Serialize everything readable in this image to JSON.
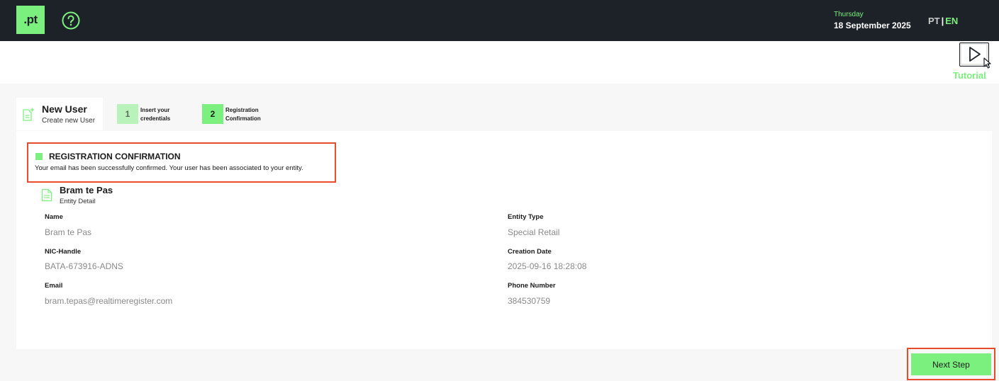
{
  "header": {
    "logo_text": ".pt",
    "day": "Thursday",
    "date": "18 September 2025",
    "lang_pt": "PT",
    "lang_sep": "|",
    "lang_en": "EN",
    "accent_color": "#7cf07f",
    "bar_color": "#1c2228"
  },
  "tutorial": {
    "label": "Tutorial",
    "icon": "play-tutorial-icon"
  },
  "steps": {
    "current": {
      "title": "New User",
      "subtitle": "Create new User",
      "icon": "add-document-icon"
    },
    "items": [
      {
        "number": "1",
        "label": "Insert your credentials"
      },
      {
        "number": "2",
        "label": "Registration Confirmation"
      }
    ]
  },
  "confirmation": {
    "title": "REGISTRATION CONFIRMATION",
    "message": "Your email has been successfully confirmed. Your user has been associated to your entity."
  },
  "entity": {
    "name": "Bram te Pas",
    "subtitle": "Entity Detail",
    "fields": {
      "name": {
        "label": "Name",
        "value": "Bram te Pas"
      },
      "entity_type": {
        "label": "Entity Type",
        "value": "Special Retail"
      },
      "nic_handle": {
        "label": "NIC-Handle",
        "value": "BATA-673916-ADNS"
      },
      "creation_date": {
        "label": "Creation Date",
        "value": "2025-09-16 18:28:08"
      },
      "email": {
        "label": "Email",
        "value": "bram.tepas@realtimeregister.com"
      },
      "phone": {
        "label": "Phone Number",
        "value": "384530759"
      }
    }
  },
  "actions": {
    "next_label": "Next Step"
  }
}
